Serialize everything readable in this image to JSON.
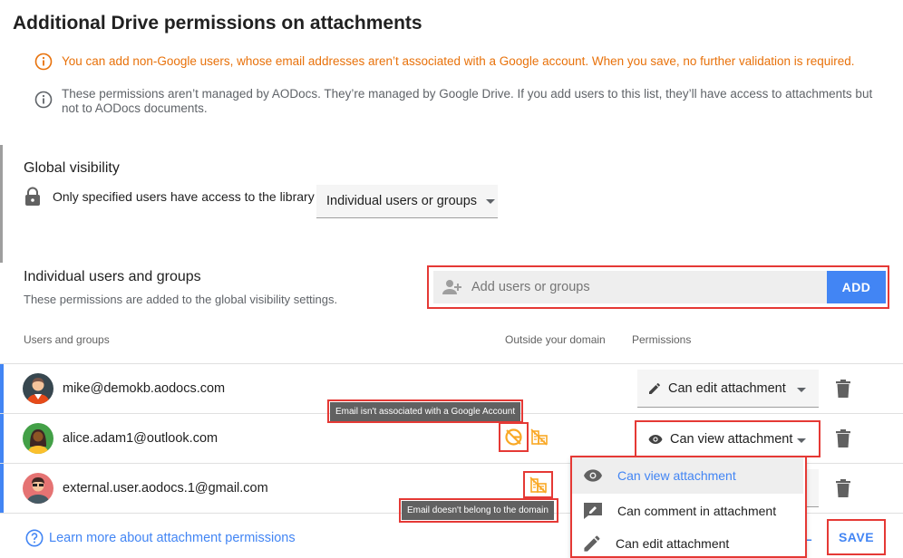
{
  "title": "Additional Drive permissions on attachments",
  "notices": {
    "warning": "You can add non-Google users, whose email addresses aren’t associated with a Google account. When you save, no further validation is required.",
    "info": "These permissions aren’t managed by AODocs. They’re managed by Google Drive. If you add users to this list, they’ll have access to attachments but not to AODocs documents."
  },
  "global_visibility": {
    "heading": "Global visibility",
    "access_text": "Only specified users have access to the library",
    "selected": "Individual users or groups"
  },
  "individual": {
    "heading": "Individual users and groups",
    "subtext": "These permissions are added to the global visibility settings.",
    "add_placeholder": "Add users or groups",
    "add_label": "ADD"
  },
  "columns": {
    "users": "Users and groups",
    "outside": "Outside your domain",
    "permissions": "Permissions"
  },
  "rows": [
    {
      "email": "mike@demokb.aodocs.com",
      "permission": "Can edit attachment"
    },
    {
      "email": "alice.adam1@outlook.com",
      "permission": "Can view attachment"
    },
    {
      "email": "external.user.aodocs.1@gmail.com",
      "permission": ""
    }
  ],
  "tooltips": {
    "not_google": "Email isn't associated with a Google Account",
    "not_domain": "Email doesn't belong to the domain"
  },
  "menu": [
    "Can view attachment",
    "Can comment in attachment",
    "Can edit attachment"
  ],
  "footer": {
    "learn_more": "Learn more about attachment permissions",
    "cancel_fragment": "L",
    "save": "SAVE"
  },
  "colors": {
    "accent": "#4285f4",
    "warning": "#e8710a",
    "outline": "#e53935",
    "domain_icon": "#f9a825"
  }
}
